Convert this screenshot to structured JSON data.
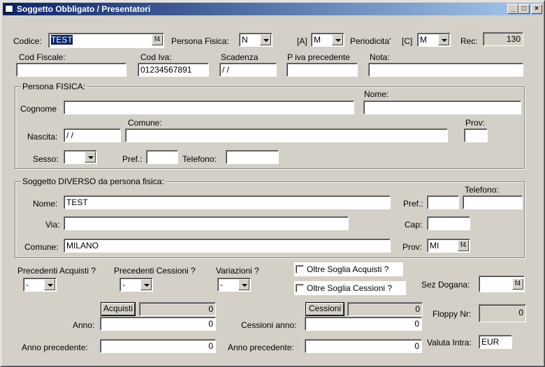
{
  "window": {
    "title": "Soggetto Obbligato / Presentatori",
    "minimize": "_",
    "maximize": "□",
    "close": "×"
  },
  "header": {
    "codice_label": "Codice:",
    "codice_value": "TEST",
    "codice_lookup": "f4",
    "persona_fisica_label": "Persona Fisica:",
    "persona_fisica_value": "N",
    "a_label": "[A]",
    "a_value": "M",
    "periodicita_label": "Periodicita'",
    "c_label": "[C]",
    "c_value": "M",
    "rec_label": "Rec:",
    "rec_value": "130",
    "cod_fiscale_label": "Cod Fiscale:",
    "cod_fiscale_value": "",
    "cod_iva_label": "Cod Iva:",
    "cod_iva_value": "01234567891",
    "scadenza_label": "Scadenza",
    "scadenza_value": "/ /",
    "piva_precedente_label": "P iva precedente",
    "piva_precedente_value": "",
    "nota_label": "Nota:",
    "nota_value": ""
  },
  "persona_fisica": {
    "group_title": "Persona FISICA:",
    "cognome_label": "Cognome",
    "cognome_value": "",
    "nome_label": "Nome:",
    "nome_value": "",
    "nascita_label": "Nascita:",
    "nascita_value": "/ /",
    "comune_label": "Comune:",
    "comune_value": "",
    "prov_label": "Prov:",
    "prov_value": "",
    "sesso_label": "Sesso:",
    "sesso_value": "",
    "pref_label": "Pref.:",
    "pref_value": "",
    "telefono_label": "Telefono:",
    "telefono_value": ""
  },
  "soggetto_diverso": {
    "group_title": "Soggetto DIVERSO da persona fisica:",
    "telefono_label": "Telefono:",
    "nome_label": "Nome:",
    "nome_value": "TEST",
    "pref_label": "Pref.:",
    "pref_value": "",
    "telefono_value": "",
    "via_label": "Via:",
    "via_value": "",
    "cap_label": "Cap:",
    "cap_value": "",
    "comune_label": "Comune:",
    "comune_value": "MILANO",
    "prov_label": "Prov:",
    "prov_value": "MI",
    "prov_lookup": "f4"
  },
  "bottom": {
    "prec_acquisti_label": "Precedenti Acquisti ?",
    "prec_acquisti_value": "-",
    "prec_cessioni_label": "Precedenti Cessioni ?",
    "prec_cessioni_value": "-",
    "variazioni_label": "Variazioni ?",
    "variazioni_value": "-",
    "oltre_soglia_acquisti": "Oltre Soglia Acquisti ?",
    "oltre_soglia_cessioni": "Oltre Soglia Cessioni ?",
    "sez_dogana_label": "Sez Dogana:",
    "sez_dogana_value": "",
    "sez_dogana_lookup": "f4",
    "acquisti_button": "Acquisti",
    "acquisti_total": "0",
    "anno_label": "Anno:",
    "anno_acquisti_value": "0",
    "anno_prec_label": "Anno precedente:",
    "anno_prec_acquisti_value": "0",
    "cessioni_button": "Cessioni",
    "cessioni_total": "0",
    "cessioni_anno_label": "Cessioni anno:",
    "cessioni_anno_value": "0",
    "anno_prec_cessioni_label": "Anno precedente:",
    "anno_prec_cessioni_value": "0",
    "floppy_label": "Floppy Nr:",
    "floppy_value": "0",
    "valuta_label": "Valuta Intra:",
    "valuta_value": "EUR"
  }
}
